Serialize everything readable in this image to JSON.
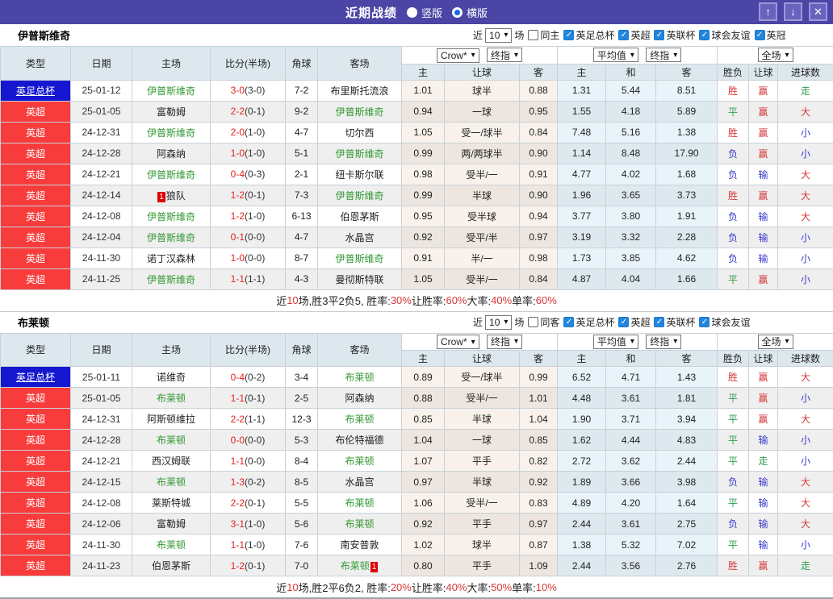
{
  "icons": {
    "chevron_down": "▾",
    "check": "✓",
    "up": "↑",
    "down": "↓",
    "close": "✕"
  },
  "titlebar": {
    "title": "近期战绩",
    "radios": [
      {
        "label": "竖版",
        "selected": false
      },
      {
        "label": "横版",
        "selected": true
      }
    ]
  },
  "thdr": {
    "type": "类型",
    "date": "日期",
    "home": "主场",
    "score": "比分(半场)",
    "corner": "角球",
    "away": "客场",
    "selects": {
      "crow": "Crow*",
      "final1": "终指",
      "avg": "平均值",
      "final2": "终指",
      "full": "全场"
    },
    "sub": {
      "h": "主",
      "hcap": "让球",
      "a": "客",
      "h2": "主",
      "d": "和",
      "a2": "客",
      "res": "胜负",
      "hcap2": "让球",
      "goals": "进球数"
    }
  },
  "sections": [
    {
      "team": "伊普斯维奇",
      "filter": {
        "near_label": "近",
        "count": "10",
        "games_label": "场",
        "same_label": "同主",
        "same_checked": false,
        "leagues": [
          "英足总杯",
          "英超",
          "英联杯",
          "球会友谊",
          "英冠"
        ]
      },
      "rows": [
        {
          "league": "英足总杯",
          "lc": "blue",
          "date": "25-01-12",
          "home": "伊普斯维奇",
          "hg": true,
          "hb": null,
          "ft": "3-0",
          "ht": "(3-0)",
          "corner": "7-2",
          "away": "布里斯托流浪",
          "ag": false,
          "ab": null,
          "o1": "1.01",
          "line": "球半",
          "o2": "0.88",
          "m1": "1.31",
          "m2": "5.44",
          "m3": "8.51",
          "r1": [
            "胜",
            "r"
          ],
          "r2": [
            "赢",
            "r"
          ],
          "r3": [
            "走",
            "g"
          ]
        },
        {
          "league": "英超",
          "lc": "red",
          "date": "25-01-05",
          "home": "富勒姆",
          "hg": false,
          "hb": null,
          "ft": "2-2",
          "ht": "(0-1)",
          "corner": "9-2",
          "away": "伊普斯维奇",
          "ag": true,
          "ab": null,
          "o1": "0.94",
          "line": "一球",
          "o2": "0.95",
          "m1": "1.55",
          "m2": "4.18",
          "m3": "5.89",
          "r1": [
            "平",
            "g"
          ],
          "r2": [
            "赢",
            "r"
          ],
          "r3": [
            "大",
            "r"
          ]
        },
        {
          "league": "英超",
          "lc": "red",
          "date": "24-12-31",
          "home": "伊普斯维奇",
          "hg": true,
          "hb": null,
          "ft": "2-0",
          "ht": "(1-0)",
          "corner": "4-7",
          "away": "切尔西",
          "ag": false,
          "ab": null,
          "o1": "1.05",
          "line": "受一/球半",
          "o2": "0.84",
          "m1": "7.48",
          "m2": "5.16",
          "m3": "1.38",
          "r1": [
            "胜",
            "r"
          ],
          "r2": [
            "赢",
            "r"
          ],
          "r3": [
            "小",
            "b"
          ]
        },
        {
          "league": "英超",
          "lc": "red",
          "date": "24-12-28",
          "home": "阿森纳",
          "hg": false,
          "hb": null,
          "ft": "1-0",
          "ht": "(1-0)",
          "corner": "5-1",
          "away": "伊普斯维奇",
          "ag": true,
          "ab": null,
          "o1": "0.99",
          "line": "两/两球半",
          "o2": "0.90",
          "m1": "1.14",
          "m2": "8.48",
          "m3": "17.90",
          "r1": [
            "负",
            "b"
          ],
          "r2": [
            "赢",
            "r"
          ],
          "r3": [
            "小",
            "b"
          ]
        },
        {
          "league": "英超",
          "lc": "red",
          "date": "24-12-21",
          "home": "伊普斯维奇",
          "hg": true,
          "hb": null,
          "ft": "0-4",
          "ht": "(0-3)",
          "corner": "2-1",
          "away": "纽卡斯尔联",
          "ag": false,
          "ab": null,
          "o1": "0.98",
          "line": "受半/一",
          "o2": "0.91",
          "m1": "4.77",
          "m2": "4.02",
          "m3": "1.68",
          "r1": [
            "负",
            "b"
          ],
          "r2": [
            "输",
            "b"
          ],
          "r3": [
            "大",
            "r"
          ]
        },
        {
          "league": "英超",
          "lc": "red",
          "date": "24-12-14",
          "home": "狼队",
          "hg": false,
          "hb": "1",
          "ft": "1-2",
          "ht": "(0-1)",
          "corner": "7-3",
          "away": "伊普斯维奇",
          "ag": true,
          "ab": null,
          "o1": "0.99",
          "line": "半球",
          "o2": "0.90",
          "m1": "1.96",
          "m2": "3.65",
          "m3": "3.73",
          "r1": [
            "胜",
            "r"
          ],
          "r2": [
            "赢",
            "r"
          ],
          "r3": [
            "大",
            "r"
          ]
        },
        {
          "league": "英超",
          "lc": "red",
          "date": "24-12-08",
          "home": "伊普斯维奇",
          "hg": true,
          "hb": null,
          "ft": "1-2",
          "ht": "(1-0)",
          "corner": "6-13",
          "away": "伯恩茅斯",
          "ag": false,
          "ab": null,
          "o1": "0.95",
          "line": "受半球",
          "o2": "0.94",
          "m1": "3.77",
          "m2": "3.80",
          "m3": "1.91",
          "r1": [
            "负",
            "b"
          ],
          "r2": [
            "输",
            "b"
          ],
          "r3": [
            "大",
            "r"
          ]
        },
        {
          "league": "英超",
          "lc": "red",
          "date": "24-12-04",
          "home": "伊普斯维奇",
          "hg": true,
          "hb": null,
          "ft": "0-1",
          "ht": "(0-0)",
          "corner": "4-7",
          "away": "水晶宫",
          "ag": false,
          "ab": null,
          "o1": "0.92",
          "line": "受平/半",
          "o2": "0.97",
          "m1": "3.19",
          "m2": "3.32",
          "m3": "2.28",
          "r1": [
            "负",
            "b"
          ],
          "r2": [
            "输",
            "b"
          ],
          "r3": [
            "小",
            "b"
          ]
        },
        {
          "league": "英超",
          "lc": "red",
          "date": "24-11-30",
          "home": "诺丁汉森林",
          "hg": false,
          "hb": null,
          "ft": "1-0",
          "ht": "(0-0)",
          "corner": "8-7",
          "away": "伊普斯维奇",
          "ag": true,
          "ab": null,
          "o1": "0.91",
          "line": "半/一",
          "o2": "0.98",
          "m1": "1.73",
          "m2": "3.85",
          "m3": "4.62",
          "r1": [
            "负",
            "b"
          ],
          "r2": [
            "输",
            "b"
          ],
          "r3": [
            "小",
            "b"
          ]
        },
        {
          "league": "英超",
          "lc": "red",
          "date": "24-11-25",
          "home": "伊普斯维奇",
          "hg": true,
          "hb": null,
          "ft": "1-1",
          "ht": "(1-1)",
          "corner": "4-3",
          "away": "曼彻斯特联",
          "ag": false,
          "ab": null,
          "o1": "1.05",
          "line": "受半/一",
          "o2": "0.84",
          "m1": "4.87",
          "m2": "4.04",
          "m3": "1.66",
          "r1": [
            "平",
            "g"
          ],
          "r2": [
            "赢",
            "r"
          ],
          "r3": [
            "小",
            "b"
          ]
        }
      ],
      "summary": {
        "parts": [
          {
            "t": "近",
            "red": false
          },
          {
            "t": "10",
            "red": true
          },
          {
            "t": "场,胜3平2负5, 胜率:",
            "red": false
          },
          {
            "t": "30%",
            "red": true
          },
          {
            "t": " 让胜率:",
            "red": false
          },
          {
            "t": "60%",
            "red": true
          },
          {
            "t": " 大率:",
            "red": false
          },
          {
            "t": "40%",
            "red": true
          },
          {
            "t": " 单率:",
            "red": false
          },
          {
            "t": "60%",
            "red": true
          }
        ]
      }
    },
    {
      "team": "布莱顿",
      "filter": {
        "near_label": "近",
        "count": "10",
        "games_label": "场",
        "same_label": "同客",
        "same_checked": false,
        "leagues": [
          "英足总杯",
          "英超",
          "英联杯",
          "球会友谊"
        ]
      },
      "rows": [
        {
          "league": "英足总杯",
          "lc": "blue",
          "date": "25-01-11",
          "home": "诺维奇",
          "hg": false,
          "hb": null,
          "ft": "0-4",
          "ht": "(0-2)",
          "corner": "3-4",
          "away": "布莱顿",
          "ag": true,
          "ab": null,
          "o1": "0.89",
          "line": "受一/球半",
          "o2": "0.99",
          "m1": "6.52",
          "m2": "4.71",
          "m3": "1.43",
          "r1": [
            "胜",
            "r"
          ],
          "r2": [
            "赢",
            "r"
          ],
          "r3": [
            "大",
            "r"
          ]
        },
        {
          "league": "英超",
          "lc": "red",
          "date": "25-01-05",
          "home": "布莱顿",
          "hg": true,
          "hb": null,
          "ft": "1-1",
          "ht": "(0-1)",
          "corner": "2-5",
          "away": "阿森纳",
          "ag": false,
          "ab": null,
          "o1": "0.88",
          "line": "受半/一",
          "o2": "1.01",
          "m1": "4.48",
          "m2": "3.61",
          "m3": "1.81",
          "r1": [
            "平",
            "g"
          ],
          "r2": [
            "赢",
            "r"
          ],
          "r3": [
            "小",
            "b"
          ]
        },
        {
          "league": "英超",
          "lc": "red",
          "date": "24-12-31",
          "home": "阿斯顿维拉",
          "hg": false,
          "hb": null,
          "ft": "2-2",
          "ht": "(1-1)",
          "corner": "12-3",
          "away": "布莱顿",
          "ag": true,
          "ab": null,
          "o1": "0.85",
          "line": "半球",
          "o2": "1.04",
          "m1": "1.90",
          "m2": "3.71",
          "m3": "3.94",
          "r1": [
            "平",
            "g"
          ],
          "r2": [
            "赢",
            "r"
          ],
          "r3": [
            "大",
            "r"
          ]
        },
        {
          "league": "英超",
          "lc": "red",
          "date": "24-12-28",
          "home": "布莱顿",
          "hg": true,
          "hb": null,
          "ft": "0-0",
          "ht": "(0-0)",
          "corner": "5-3",
          "away": "布伦特福德",
          "ag": false,
          "ab": null,
          "o1": "1.04",
          "line": "一球",
          "o2": "0.85",
          "m1": "1.62",
          "m2": "4.44",
          "m3": "4.83",
          "r1": [
            "平",
            "g"
          ],
          "r2": [
            "输",
            "b"
          ],
          "r3": [
            "小",
            "b"
          ]
        },
        {
          "league": "英超",
          "lc": "red",
          "date": "24-12-21",
          "home": "西汉姆联",
          "hg": false,
          "hb": null,
          "ft": "1-1",
          "ht": "(0-0)",
          "corner": "8-4",
          "away": "布莱顿",
          "ag": true,
          "ab": null,
          "o1": "1.07",
          "line": "平手",
          "o2": "0.82",
          "m1": "2.72",
          "m2": "3.62",
          "m3": "2.44",
          "r1": [
            "平",
            "g"
          ],
          "r2": [
            "走",
            "g"
          ],
          "r3": [
            "小",
            "b"
          ]
        },
        {
          "league": "英超",
          "lc": "red",
          "date": "24-12-15",
          "home": "布莱顿",
          "hg": true,
          "hb": null,
          "ft": "1-3",
          "ht": "(0-2)",
          "corner": "8-5",
          "away": "水晶宫",
          "ag": false,
          "ab": null,
          "o1": "0.97",
          "line": "半球",
          "o2": "0.92",
          "m1": "1.89",
          "m2": "3.66",
          "m3": "3.98",
          "r1": [
            "负",
            "b"
          ],
          "r2": [
            "输",
            "b"
          ],
          "r3": [
            "大",
            "r"
          ]
        },
        {
          "league": "英超",
          "lc": "red",
          "date": "24-12-08",
          "home": "莱斯特城",
          "hg": false,
          "hb": null,
          "ft": "2-2",
          "ht": "(0-1)",
          "corner": "5-5",
          "away": "布莱顿",
          "ag": true,
          "ab": null,
          "o1": "1.06",
          "line": "受半/一",
          "o2": "0.83",
          "m1": "4.89",
          "m2": "4.20",
          "m3": "1.64",
          "r1": [
            "平",
            "g"
          ],
          "r2": [
            "输",
            "b"
          ],
          "r3": [
            "大",
            "r"
          ]
        },
        {
          "league": "英超",
          "lc": "red",
          "date": "24-12-06",
          "home": "富勒姆",
          "hg": false,
          "hb": null,
          "ft": "3-1",
          "ht": "(1-0)",
          "corner": "5-6",
          "away": "布莱顿",
          "ag": true,
          "ab": null,
          "o1": "0.92",
          "line": "平手",
          "o2": "0.97",
          "m1": "2.44",
          "m2": "3.61",
          "m3": "2.75",
          "r1": [
            "负",
            "b"
          ],
          "r2": [
            "输",
            "b"
          ],
          "r3": [
            "大",
            "r"
          ]
        },
        {
          "league": "英超",
          "lc": "red",
          "date": "24-11-30",
          "home": "布莱顿",
          "hg": true,
          "hb": null,
          "ft": "1-1",
          "ht": "(1-0)",
          "corner": "7-6",
          "away": "南安普敦",
          "ag": false,
          "ab": null,
          "o1": "1.02",
          "line": "球半",
          "o2": "0.87",
          "m1": "1.38",
          "m2": "5.32",
          "m3": "7.02",
          "r1": [
            "平",
            "g"
          ],
          "r2": [
            "输",
            "b"
          ],
          "r3": [
            "小",
            "b"
          ]
        },
        {
          "league": "英超",
          "lc": "red",
          "date": "24-11-23",
          "home": "伯恩茅斯",
          "hg": false,
          "hb": null,
          "ft": "1-2",
          "ht": "(0-1)",
          "corner": "7-0",
          "away": "布莱顿",
          "ag": true,
          "ab": "1",
          "o1": "0.80",
          "line": "平手",
          "o2": "1.09",
          "m1": "2.44",
          "m2": "3.56",
          "m3": "2.76",
          "r1": [
            "胜",
            "r"
          ],
          "r2": [
            "赢",
            "r"
          ],
          "r3": [
            "走",
            "g"
          ]
        }
      ],
      "summary": {
        "parts": [
          {
            "t": "近",
            "red": false
          },
          {
            "t": "10",
            "red": true
          },
          {
            "t": "场,胜2平6负2, 胜率:",
            "red": false
          },
          {
            "t": "20%",
            "red": true
          },
          {
            "t": " 让胜率:",
            "red": false
          },
          {
            "t": "40%",
            "red": true
          },
          {
            "t": " 大率:",
            "red": false
          },
          {
            "t": "50%",
            "red": true
          },
          {
            "t": " 单率:",
            "red": false
          },
          {
            "t": "10%",
            "red": true
          }
        ]
      }
    }
  ]
}
